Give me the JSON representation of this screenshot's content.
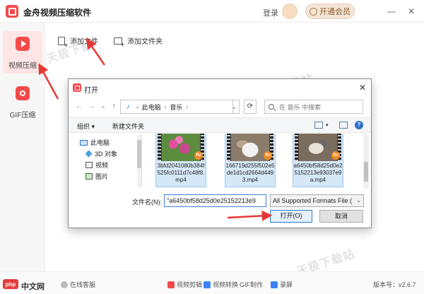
{
  "app": {
    "title": "金舟视频压缩软件",
    "login": "登录",
    "vip_label": "开通会员",
    "minimize": "—",
    "close": "✕"
  },
  "sidebar": {
    "items": [
      {
        "label": "视频压缩",
        "icon": "video-compress-icon"
      },
      {
        "label": "GIF压缩",
        "icon": "gif-compress-icon"
      }
    ]
  },
  "toolbar": {
    "add_file": "添加文件",
    "add_folder": "添加文件夹"
  },
  "watermarks": [
    "天极下载",
    "天极下载站",
    "天极下载站"
  ],
  "bottom": {
    "support": "在线客服",
    "tools": [
      "视频剪辑",
      "视频转换",
      "GIF制作",
      "录屏"
    ],
    "version": "版本号：v2.6.7",
    "brand": "php",
    "brand_text": "中文网"
  },
  "dialog": {
    "title": "打开",
    "close": "✕",
    "nav": {
      "back": "←",
      "forward": "→",
      "dropdown": "⌄",
      "up": "↑"
    },
    "address": [
      "此电脑",
      "音乐"
    ],
    "refresh": "⟳",
    "search_placeholder": "在 音乐 中搜索",
    "cmdbar": {
      "organize": "组织 ▾",
      "new_folder": "新建文件夹"
    },
    "tree": [
      "此电脑",
      "3D 对象",
      "视频",
      "图片"
    ],
    "files": [
      {
        "name": "3bfd2041080b384f525fc0111d7c48f8.mp4",
        "badge": "flv"
      },
      {
        "name": "166719d255f502e5de1d1cd2664d4493.mp4",
        "badge": "flv"
      },
      {
        "name": "a6450bf58d25d0e25152213e93037e9a.mp4",
        "badge": "flv"
      }
    ],
    "filename_label": "文件名(N):",
    "filename_value": "\"a6450bf58d25d0e25152213e9",
    "filetype_value": "All Supported Formats File (",
    "open_button": "打开(O)",
    "cancel_button": "取消"
  },
  "colors": {
    "accent": "#f44a4a",
    "dialog_accent": "#2a78d4",
    "annotation": "#e53935"
  }
}
